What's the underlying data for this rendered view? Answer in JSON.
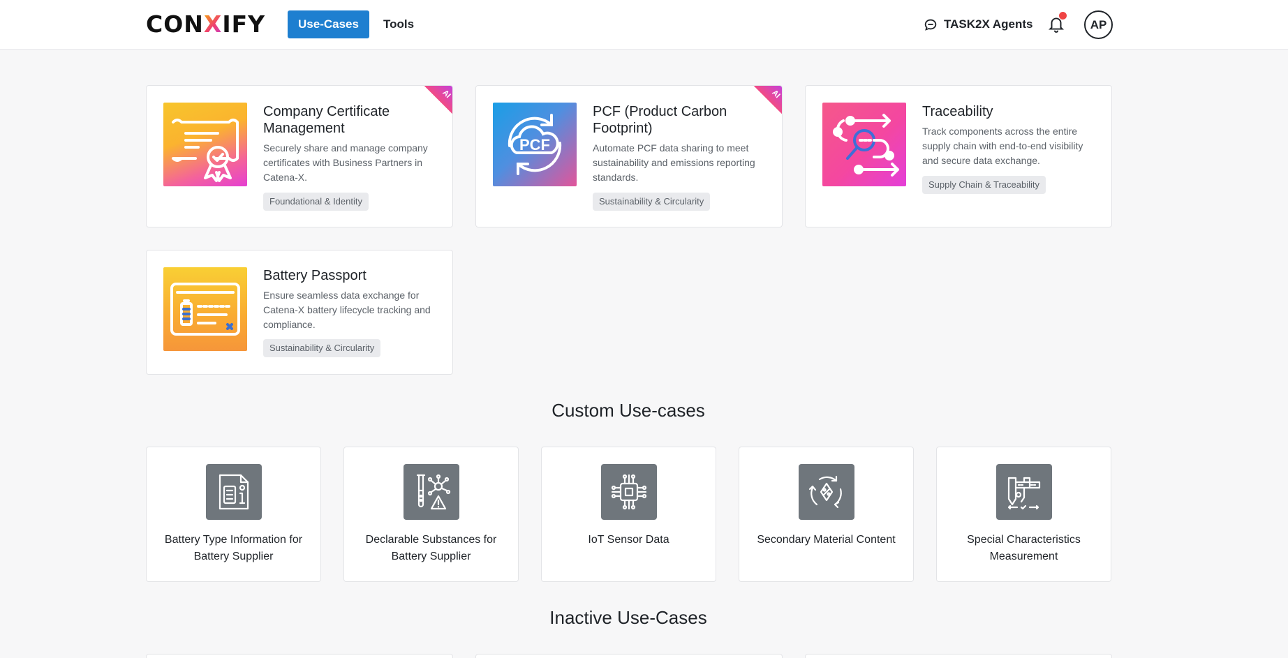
{
  "header": {
    "logo": {
      "pre": "CON",
      "x": "X",
      "post": "IFY"
    },
    "nav": {
      "usecases": "Use-Cases",
      "tools": "Tools"
    },
    "agents_label": "TASK2X Agents",
    "avatar_initials": "AP",
    "accent": "#1e7fd0",
    "notification_dot_color": "#ef4444"
  },
  "cards": [
    {
      "title": "Company Certificate Management",
      "description": "Securely share and manage company certificates with Business Partners in Catena-X.",
      "tag": "Foundational & Identity",
      "ai_badge": "AI",
      "icon": "certificate-icon"
    },
    {
      "title": "PCF (Product Carbon Footprint)",
      "description": "Automate PCF data sharing to meet sustainability and emissions reporting standards.",
      "tag": "Sustainability & Circularity",
      "ai_badge": "AI",
      "icon_text": "PCF",
      "icon": "pcf-cloud-icon"
    },
    {
      "title": "Traceability",
      "description": "Track components across the entire supply chain with end-to-end visibility and secure data exchange.",
      "tag": "Supply Chain & Traceability",
      "icon": "traceability-icon"
    },
    {
      "title": "Battery Passport",
      "description": "Ensure seamless data exchange for Catena-X battery lifecycle tracking and compliance.",
      "tag": "Sustainability & Circularity",
      "icon": "battery-passport-icon"
    }
  ],
  "custom_section": {
    "title": "Custom Use-cases",
    "items": [
      {
        "label": "Battery Type Information for Battery Supplier",
        "icon": "document-info-icon"
      },
      {
        "label": "Declarable Substances for Battery Supplier",
        "icon": "substances-icon"
      },
      {
        "label": "IoT Sensor Data",
        "icon": "chip-sensor-icon"
      },
      {
        "label": "Secondary Material Content",
        "icon": "recycle-percent-icon"
      },
      {
        "label": "Special Characteristics Measurement",
        "icon": "caliper-icon"
      }
    ]
  },
  "inactive_section": {
    "title": "Inactive Use-Cases"
  }
}
